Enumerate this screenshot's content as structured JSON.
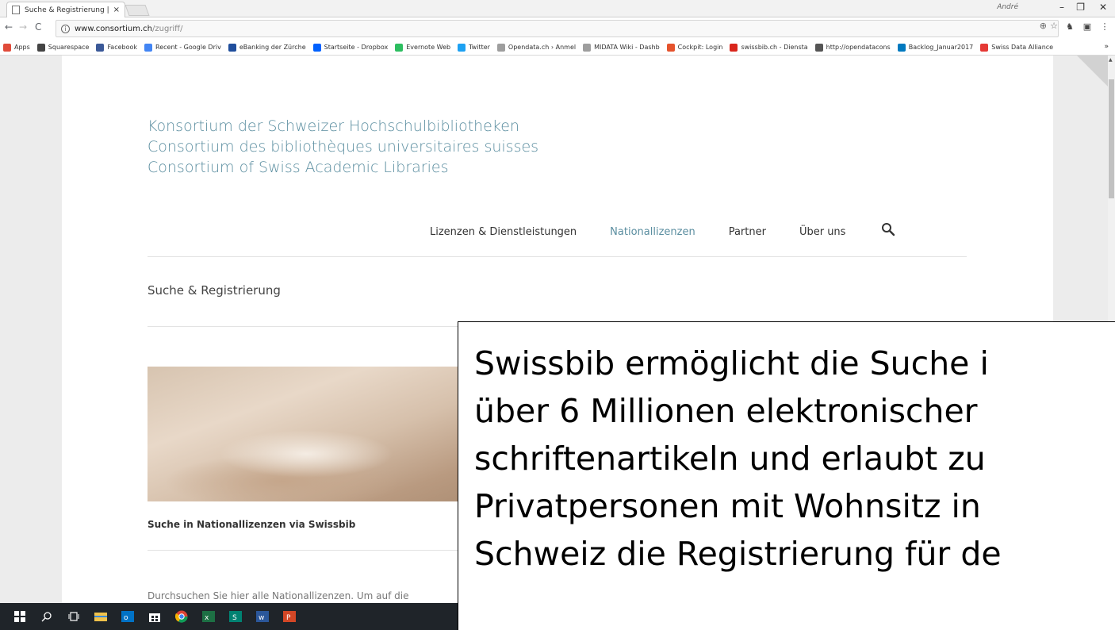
{
  "browser": {
    "tab_title": "Suche & Registrierung | ",
    "tab_close": "×",
    "user_name": "André",
    "window_minimize": "–",
    "window_restore": "❐",
    "window_close": "✕",
    "url_host": "www.consortium.ch",
    "url_path": "/zugriff/",
    "bookmarks": [
      {
        "label": "Apps",
        "color": "#e04b3a"
      },
      {
        "label": "Squarespace",
        "color": "#444444"
      },
      {
        "label": "Facebook",
        "color": "#3b5998"
      },
      {
        "label": "Recent - Google Driv",
        "color": "#4285f4"
      },
      {
        "label": "eBanking der Zürche",
        "color": "#1f4e9c"
      },
      {
        "label": "Startseite - Dropbox",
        "color": "#0061fe"
      },
      {
        "label": "Evernote Web",
        "color": "#2dbe60"
      },
      {
        "label": "Twitter",
        "color": "#1da1f2"
      },
      {
        "label": "Opendata.ch › Anmel",
        "color": "#9e9e9e"
      },
      {
        "label": "MIDATA Wiki - Dashb",
        "color": "#9e9e9e"
      },
      {
        "label": "Cockpit: Login",
        "color": "#e5532d"
      },
      {
        "label": "swissbib.ch - Diensta",
        "color": "#d9261c"
      },
      {
        "label": "http://opendatacons",
        "color": "#555555"
      },
      {
        "label": "Backlog_Januar2017",
        "color": "#0079bf"
      },
      {
        "label": "Swiss Data Alliance",
        "color": "#e53935"
      }
    ],
    "bookmarks_more": "»"
  },
  "site": {
    "title_lines": [
      "Konsortium der Schweizer Hochschulbibliotheken",
      "Consortium des bibliothèques universitaires suisses",
      "Consortium of Swiss Academic Libraries"
    ],
    "nav": [
      {
        "label": "Lizenzen & Dienstleistungen",
        "active": false
      },
      {
        "label": "Nationallizenzen",
        "active": true
      },
      {
        "label": "Partner",
        "active": false
      },
      {
        "label": "Über uns",
        "active": false
      }
    ],
    "accent_color": "#5b8ea0"
  },
  "page": {
    "heading": "Suche & Registrierung",
    "section_title": "Suche in Nationallizenzen via Swissbib",
    "section_text": "Durchsuchen Sie hier alle Nationallizenzen. Um auf die"
  },
  "caption": {
    "lines": [
      "Swissbib ermöglicht die Suche i",
      "über 6 Millionen elektronischer",
      "schriftenartikeln und erlaubt zu",
      "Privatpersonen mit Wohnsitz in",
      "Schweiz die Registrierung für de"
    ]
  },
  "taskbar": {
    "icons": [
      "windows-start-icon",
      "cortana-search-icon",
      "task-view-icon",
      "file-explorer-icon",
      "outlook-icon",
      "store-icon",
      "chrome-icon",
      "excel-icon",
      "sway-icon",
      "word-icon",
      "powerpoint-icon"
    ]
  }
}
